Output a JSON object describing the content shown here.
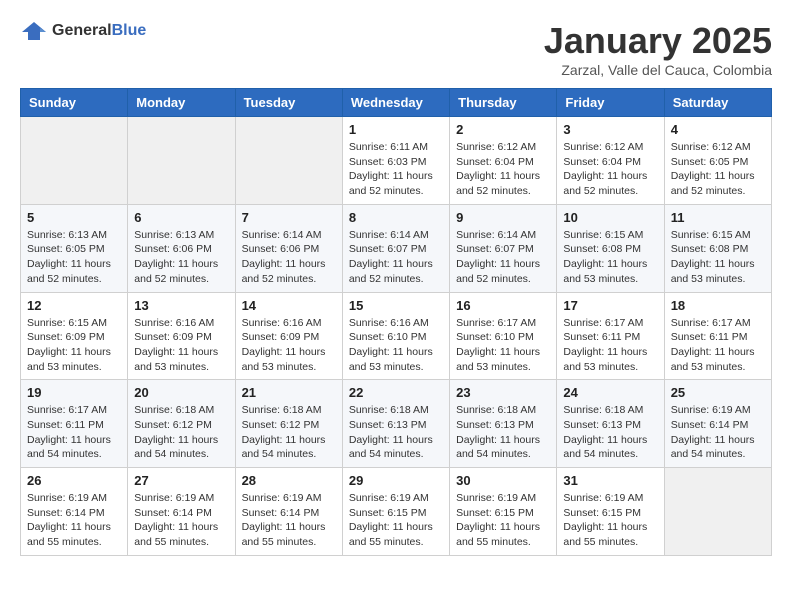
{
  "logo": {
    "general": "General",
    "blue": "Blue"
  },
  "header": {
    "month": "January 2025",
    "location": "Zarzal, Valle del Cauca, Colombia"
  },
  "weekdays": [
    "Sunday",
    "Monday",
    "Tuesday",
    "Wednesday",
    "Thursday",
    "Friday",
    "Saturday"
  ],
  "weeks": [
    [
      {
        "day": "",
        "info": ""
      },
      {
        "day": "",
        "info": ""
      },
      {
        "day": "",
        "info": ""
      },
      {
        "day": "1",
        "info": "Sunrise: 6:11 AM\nSunset: 6:03 PM\nDaylight: 11 hours\nand 52 minutes."
      },
      {
        "day": "2",
        "info": "Sunrise: 6:12 AM\nSunset: 6:04 PM\nDaylight: 11 hours\nand 52 minutes."
      },
      {
        "day": "3",
        "info": "Sunrise: 6:12 AM\nSunset: 6:04 PM\nDaylight: 11 hours\nand 52 minutes."
      },
      {
        "day": "4",
        "info": "Sunrise: 6:12 AM\nSunset: 6:05 PM\nDaylight: 11 hours\nand 52 minutes."
      }
    ],
    [
      {
        "day": "5",
        "info": "Sunrise: 6:13 AM\nSunset: 6:05 PM\nDaylight: 11 hours\nand 52 minutes."
      },
      {
        "day": "6",
        "info": "Sunrise: 6:13 AM\nSunset: 6:06 PM\nDaylight: 11 hours\nand 52 minutes."
      },
      {
        "day": "7",
        "info": "Sunrise: 6:14 AM\nSunset: 6:06 PM\nDaylight: 11 hours\nand 52 minutes."
      },
      {
        "day": "8",
        "info": "Sunrise: 6:14 AM\nSunset: 6:07 PM\nDaylight: 11 hours\nand 52 minutes."
      },
      {
        "day": "9",
        "info": "Sunrise: 6:14 AM\nSunset: 6:07 PM\nDaylight: 11 hours\nand 52 minutes."
      },
      {
        "day": "10",
        "info": "Sunrise: 6:15 AM\nSunset: 6:08 PM\nDaylight: 11 hours\nand 53 minutes."
      },
      {
        "day": "11",
        "info": "Sunrise: 6:15 AM\nSunset: 6:08 PM\nDaylight: 11 hours\nand 53 minutes."
      }
    ],
    [
      {
        "day": "12",
        "info": "Sunrise: 6:15 AM\nSunset: 6:09 PM\nDaylight: 11 hours\nand 53 minutes."
      },
      {
        "day": "13",
        "info": "Sunrise: 6:16 AM\nSunset: 6:09 PM\nDaylight: 11 hours\nand 53 minutes."
      },
      {
        "day": "14",
        "info": "Sunrise: 6:16 AM\nSunset: 6:09 PM\nDaylight: 11 hours\nand 53 minutes."
      },
      {
        "day": "15",
        "info": "Sunrise: 6:16 AM\nSunset: 6:10 PM\nDaylight: 11 hours\nand 53 minutes."
      },
      {
        "day": "16",
        "info": "Sunrise: 6:17 AM\nSunset: 6:10 PM\nDaylight: 11 hours\nand 53 minutes."
      },
      {
        "day": "17",
        "info": "Sunrise: 6:17 AM\nSunset: 6:11 PM\nDaylight: 11 hours\nand 53 minutes."
      },
      {
        "day": "18",
        "info": "Sunrise: 6:17 AM\nSunset: 6:11 PM\nDaylight: 11 hours\nand 53 minutes."
      }
    ],
    [
      {
        "day": "19",
        "info": "Sunrise: 6:17 AM\nSunset: 6:11 PM\nDaylight: 11 hours\nand 54 minutes."
      },
      {
        "day": "20",
        "info": "Sunrise: 6:18 AM\nSunset: 6:12 PM\nDaylight: 11 hours\nand 54 minutes."
      },
      {
        "day": "21",
        "info": "Sunrise: 6:18 AM\nSunset: 6:12 PM\nDaylight: 11 hours\nand 54 minutes."
      },
      {
        "day": "22",
        "info": "Sunrise: 6:18 AM\nSunset: 6:13 PM\nDaylight: 11 hours\nand 54 minutes."
      },
      {
        "day": "23",
        "info": "Sunrise: 6:18 AM\nSunset: 6:13 PM\nDaylight: 11 hours\nand 54 minutes."
      },
      {
        "day": "24",
        "info": "Sunrise: 6:18 AM\nSunset: 6:13 PM\nDaylight: 11 hours\nand 54 minutes."
      },
      {
        "day": "25",
        "info": "Sunrise: 6:19 AM\nSunset: 6:14 PM\nDaylight: 11 hours\nand 54 minutes."
      }
    ],
    [
      {
        "day": "26",
        "info": "Sunrise: 6:19 AM\nSunset: 6:14 PM\nDaylight: 11 hours\nand 55 minutes."
      },
      {
        "day": "27",
        "info": "Sunrise: 6:19 AM\nSunset: 6:14 PM\nDaylight: 11 hours\nand 55 minutes."
      },
      {
        "day": "28",
        "info": "Sunrise: 6:19 AM\nSunset: 6:14 PM\nDaylight: 11 hours\nand 55 minutes."
      },
      {
        "day": "29",
        "info": "Sunrise: 6:19 AM\nSunset: 6:15 PM\nDaylight: 11 hours\nand 55 minutes."
      },
      {
        "day": "30",
        "info": "Sunrise: 6:19 AM\nSunset: 6:15 PM\nDaylight: 11 hours\nand 55 minutes."
      },
      {
        "day": "31",
        "info": "Sunrise: 6:19 AM\nSunset: 6:15 PM\nDaylight: 11 hours\nand 55 minutes."
      },
      {
        "day": "",
        "info": ""
      }
    ]
  ]
}
